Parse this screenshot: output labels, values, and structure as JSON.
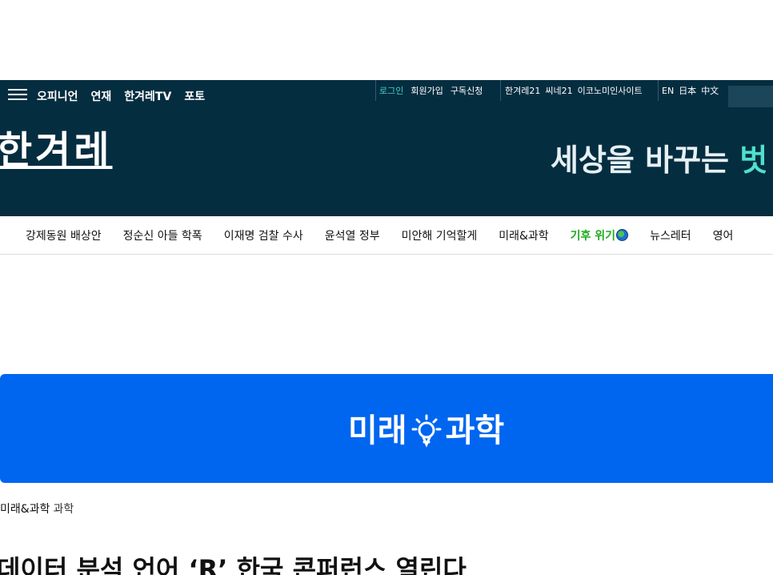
{
  "header": {
    "primary_nav": [
      "오피니언",
      "연재",
      "한겨레TV",
      "포토"
    ],
    "account_links": [
      "로그인",
      "회원가입",
      "구독신청"
    ],
    "family_sites": [
      "한겨레21",
      "씨네21",
      "이코노미인사이트"
    ],
    "languages": [
      "EN",
      "日本",
      "中文"
    ],
    "logo_text": "한겨레",
    "slogan_prefix": "세상을 바꾸는 ",
    "slogan_accent": "벗"
  },
  "section_nav": {
    "items": [
      "강제동원 배상안",
      "정순신 아들 학폭",
      "이재명 검찰 수사",
      "윤석열 정부",
      "미안해 기억할게",
      "미래&과학",
      "기후 위기",
      "뉴스레터",
      "영어"
    ]
  },
  "banner": {
    "left_text": "미래",
    "right_text": "과학"
  },
  "breadcrumb": {
    "section": "미래&과학",
    "subsection": "과학"
  },
  "article": {
    "headline": "데이터 분석 언어 ‘R’ 한국 콘퍼런스 열린다"
  },
  "colors": {
    "header_bg": "#052d40",
    "banner_bg": "#0066f0",
    "accent": "#4fe0cb",
    "climate_green": "#1faa1f"
  }
}
